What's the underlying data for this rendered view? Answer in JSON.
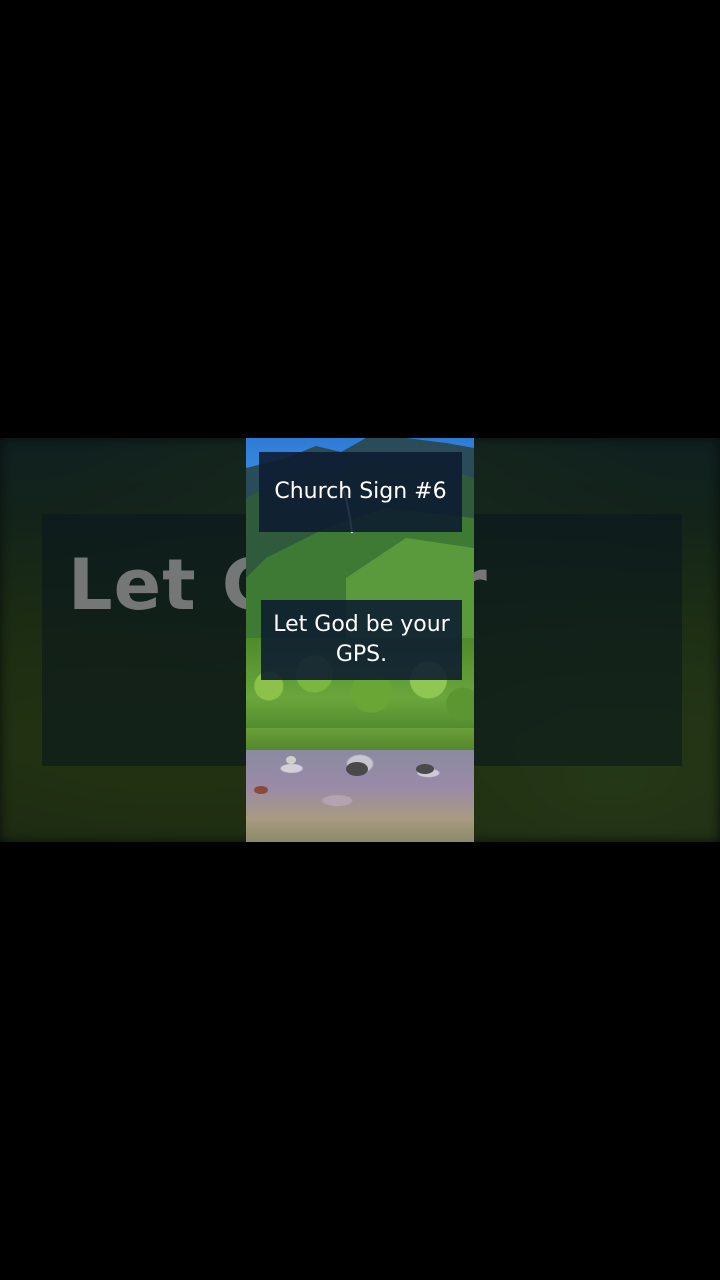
{
  "video": {
    "title_caption": "Church Sign #6",
    "body_caption": "Let God be your GPS.",
    "background_caption_visible": "Let G          your"
  },
  "colors": {
    "caption_background": "#0c1a30",
    "caption_text": "#ffffff",
    "letterbox": "#000000"
  }
}
